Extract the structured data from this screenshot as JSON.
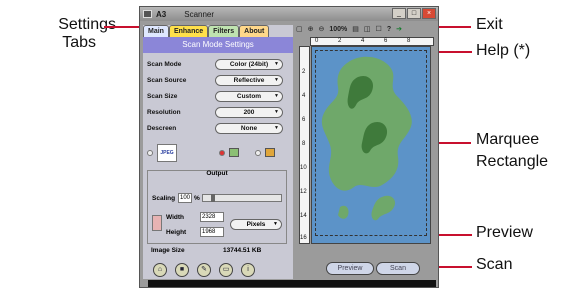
{
  "window": {
    "title": "A3",
    "app_name": "Scanner"
  },
  "tabs": [
    "Main",
    "Enhance",
    "Filters",
    "About"
  ],
  "panel_title": "Scan Mode Settings",
  "settings": [
    {
      "label": "Scan Mode",
      "value": "Color (24bit)"
    },
    {
      "label": "Scan Source",
      "value": "Reflective"
    },
    {
      "label": "Scan Size",
      "value": "Custom"
    },
    {
      "label": "Resolution",
      "value": "200"
    },
    {
      "label": "Descreen",
      "value": "None"
    }
  ],
  "format_badge": "JPEG",
  "output": {
    "title": "Output",
    "scaling_label": "Scaling",
    "scaling_value": "100",
    "scaling_unit": "%",
    "width_label": "Width",
    "width_value": "2328",
    "height_label": "Height",
    "height_value": "1968",
    "units": "Pixels",
    "image_size_label": "Image Size",
    "image_size_value": "13744.51 KB"
  },
  "toolbar": {
    "zoom_label": "100%"
  },
  "ruler": {
    "h_ticks": [
      "0",
      "2",
      "4",
      "6",
      "8"
    ],
    "v_ticks": [
      "2",
      "4",
      "6",
      "8",
      "10",
      "12",
      "14",
      "16"
    ]
  },
  "buttons": {
    "preview": "Preview",
    "scan": "Scan"
  },
  "callouts": {
    "settings_tabs_line1": "Settings",
    "settings_tabs_line2": "Tabs",
    "exit": "Exit",
    "help": "Help (*)",
    "marquee_line1": "Marquee",
    "marquee_line2": "Rectangle",
    "preview": "Preview",
    "scan": "Scan"
  },
  "colors": {
    "callout_line": "#c8102e",
    "panel_header": "#8b86d8",
    "map_sea": "#5c93c8",
    "map_land": "#6fa86a"
  }
}
